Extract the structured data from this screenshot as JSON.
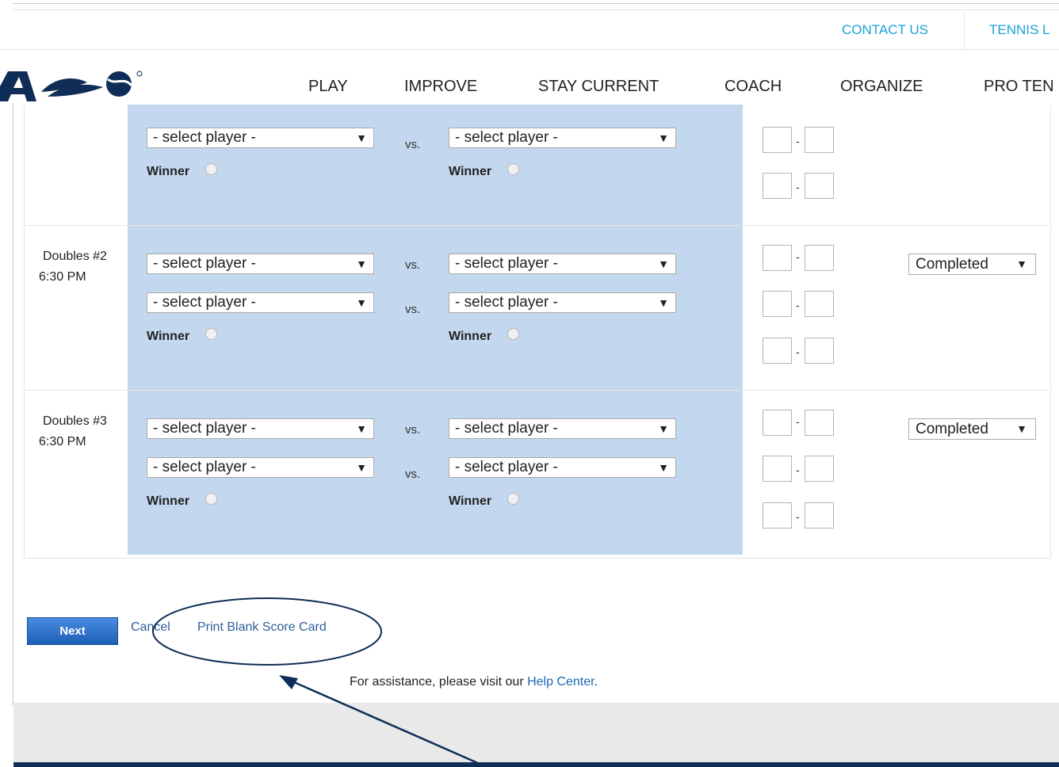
{
  "utility_nav": {
    "contact": "CONTACT US",
    "tennis": "TENNIS L"
  },
  "main_nav": [
    "PLAY",
    "IMPROVE",
    "STAY CURRENT",
    "COACH",
    "ORGANIZE",
    "PRO TEN"
  ],
  "logo_text": "A",
  "common": {
    "select_placeholder": "- select player -",
    "vs": "vs.",
    "winner": "Winner",
    "score_dash": "-",
    "caret": "▼"
  },
  "matches": [
    {
      "name": "",
      "time": "",
      "status": ""
    },
    {
      "name": "Doubles #2",
      "time": "6:30 PM",
      "status": "Completed"
    },
    {
      "name": "Doubles #3",
      "time": "6:30 PM",
      "status": "Completed"
    }
  ],
  "actions": {
    "next": "Next",
    "cancel": "Cancel",
    "print": "Print Blank Score Card"
  },
  "help": {
    "prefix": "For assistance, please visit our ",
    "link": "Help Center",
    "suffix": "."
  },
  "colors": {
    "band": "#c3d7ee",
    "link": "#1aa3d8",
    "button": "#1c5fb6",
    "annotation": "#0f2d57"
  }
}
